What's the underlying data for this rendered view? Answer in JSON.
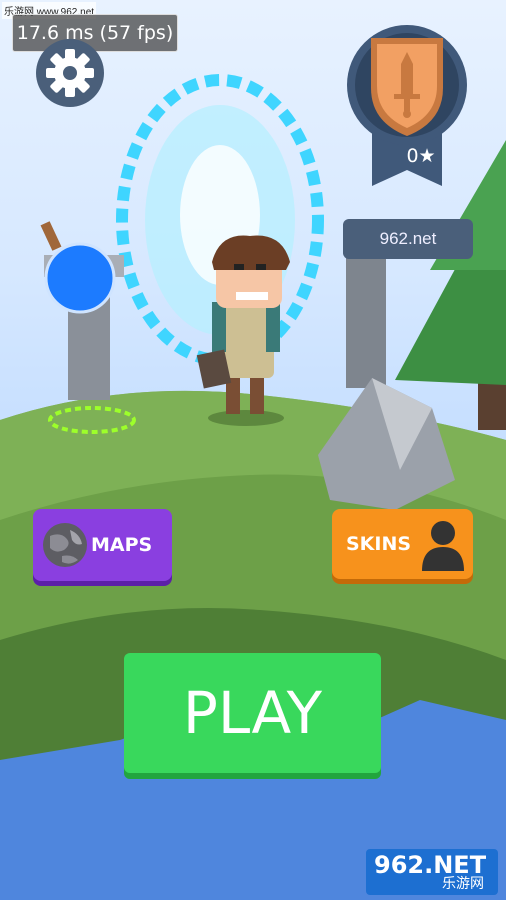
{
  "watermark_top": "乐游网 www.962.net",
  "fps_counter": "17.6 ms (57 fps)",
  "rank": {
    "stars": "0★"
  },
  "sign_text": "962.net",
  "buttons": {
    "maps": "MAPS",
    "skins": "SKINS",
    "play": "PLAY"
  },
  "watermark_bottom": {
    "logo": "962.NET",
    "sub": "乐游网"
  },
  "icons": [
    "gear-icon",
    "sword-icon",
    "globe-icon",
    "person-icon"
  ],
  "colors": {
    "play": "#39d85c",
    "maps": "#8a3fe0",
    "skins": "#f7921c",
    "portal": "#3fd5ff"
  }
}
